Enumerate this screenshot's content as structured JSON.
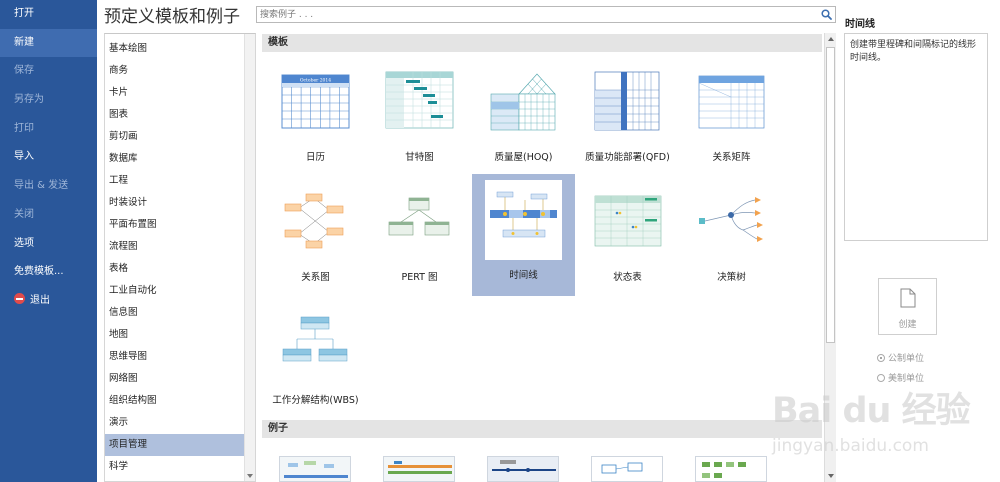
{
  "file_menu": {
    "items": [
      {
        "label": "打开"
      },
      {
        "label": "新建"
      },
      {
        "label": "保存"
      },
      {
        "label": "另存为"
      },
      {
        "label": "打印"
      },
      {
        "label": "导入"
      },
      {
        "label": "导出 & 发送"
      },
      {
        "label": "关闭"
      },
      {
        "label": "选项"
      },
      {
        "label": "免费模板..."
      },
      {
        "label": "退出"
      }
    ],
    "active_index": 1,
    "colors": {
      "background": "#2a579a",
      "active": "#3f6cb0"
    }
  },
  "page_title": "预定义模板和例子",
  "search": {
    "placeholder": "搜索例子 . . ."
  },
  "categories": {
    "items": [
      {
        "label": "基本绘图"
      },
      {
        "label": "商务"
      },
      {
        "label": "卡片"
      },
      {
        "label": "图表"
      },
      {
        "label": "剪切画"
      },
      {
        "label": "数据库"
      },
      {
        "label": "工程"
      },
      {
        "label": "时装设计"
      },
      {
        "label": "平面布置图"
      },
      {
        "label": "流程图"
      },
      {
        "label": "表格"
      },
      {
        "label": "工业自动化"
      },
      {
        "label": "信息图"
      },
      {
        "label": "地图"
      },
      {
        "label": "思维导图"
      },
      {
        "label": "网络图"
      },
      {
        "label": "组织结构图"
      },
      {
        "label": "演示"
      },
      {
        "label": "项目管理"
      },
      {
        "label": "科学"
      }
    ],
    "selected_index": 18
  },
  "gallery": {
    "templates_header": "模板",
    "examples_header": "例子",
    "templates": [
      {
        "label": "日历",
        "icon": "calendar-thumbnail",
        "calendar_title": "October 2014"
      },
      {
        "label": "甘特图",
        "icon": "gantt-thumbnail"
      },
      {
        "label": "质量屋(HOQ)",
        "icon": "house-of-quality-thumbnail"
      },
      {
        "label": "质量功能部署(QFD)",
        "icon": "qfd-thumbnail"
      },
      {
        "label": "关系矩阵",
        "icon": "relation-matrix-thumbnail"
      },
      {
        "label": "关系图",
        "icon": "relation-diagram-thumbnail"
      },
      {
        "label": "PERT 图",
        "icon": "pert-thumbnail"
      },
      {
        "label": "时间线",
        "icon": "timeline-thumbnail"
      },
      {
        "label": "状态表",
        "icon": "status-table-thumbnail"
      },
      {
        "label": "决策树",
        "icon": "decision-tree-thumbnail"
      },
      {
        "label": "工作分解结构(WBS)",
        "icon": "wbs-thumbnail"
      }
    ],
    "selected_index": 7,
    "selection_color": "#a7b8d8"
  },
  "preview": {
    "title": "时间线",
    "description": "创建带里程碑和间隔标记的线形时间线。",
    "create_label": "创建",
    "units": [
      {
        "label": "公制单位",
        "selected": true
      },
      {
        "label": "美制单位",
        "selected": false
      }
    ]
  },
  "watermark": {
    "logo": "Bai du 经验",
    "url": "jingyan.baidu.com"
  }
}
